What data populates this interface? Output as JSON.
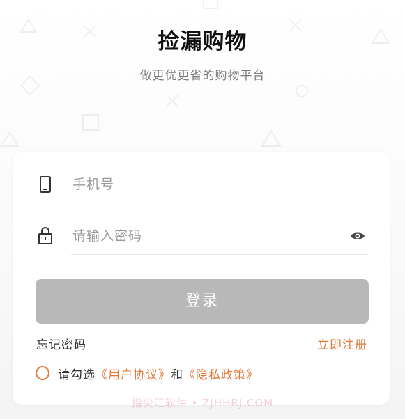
{
  "app": {
    "title": "捡漏购物",
    "subtitle": "做更优更省的购物平台"
  },
  "form": {
    "phone": {
      "placeholder": "手机号",
      "value": "",
      "icon": "phone-icon"
    },
    "password": {
      "placeholder": "请输入密码",
      "value": "",
      "icon": "lock-icon",
      "toggle_icon": "eye-icon"
    },
    "login_label": "登录",
    "forgot_label": "忘记密码",
    "register_label": "立即注册"
  },
  "agreement": {
    "prefix": "请勾选",
    "user_agreement": "《用户协议》",
    "conjunction": "和",
    "privacy_policy": "《隐私政策》",
    "checked": false
  },
  "watermark": "指尖汇软件 • ZJHHRJ.COM",
  "colors": {
    "accent": "#e07a3a",
    "button_disabled": "#b8b8b8",
    "title": "#111111",
    "subtitle": "#7a7a7a"
  }
}
